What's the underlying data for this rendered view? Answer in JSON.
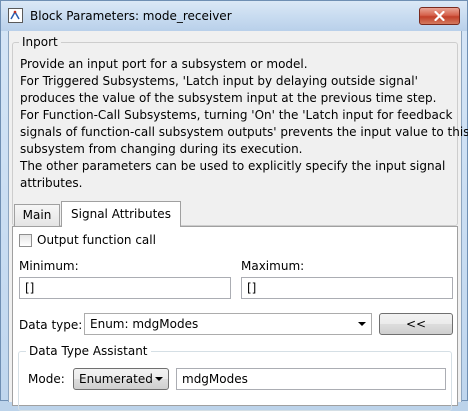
{
  "window": {
    "title": "Block Parameters: mode_receiver"
  },
  "inport": {
    "group_label": "Inport",
    "description_lines": [
      "Provide an input port for a subsystem or model.",
      "For Triggered Subsystems, 'Latch input by delaying outside signal'",
      "produces the value of the subsystem input at the previous time step.",
      "For Function-Call Subsystems, turning 'On' the 'Latch input for feedback",
      "signals of function-call subsystem outputs' prevents the input value to this",
      "subsystem from changing during its execution.",
      "The other parameters can be used to explicitly specify the input signal",
      "attributes."
    ]
  },
  "tabs": [
    {
      "label": "Main",
      "selected": false
    },
    {
      "label": "Signal Attributes",
      "selected": true
    }
  ],
  "signal_attributes": {
    "output_function_call": {
      "label": "Output function call",
      "checked": false
    },
    "minimum": {
      "label": "Minimum:",
      "value": "[]"
    },
    "maximum": {
      "label": "Maximum:",
      "value": "[]"
    },
    "data_type": {
      "label": "Data type:",
      "value": "Enum: mdgModes",
      "toggle_button": "<<"
    },
    "assistant": {
      "label": "Data Type Assistant",
      "mode_label": "Mode:",
      "mode_value": "Enumerated",
      "name_value": "mdgModes"
    }
  },
  "colors": {
    "title_bar": "#c7dbf0",
    "close_button": "#c2402a",
    "dialog_background": "#f0f0f0"
  }
}
